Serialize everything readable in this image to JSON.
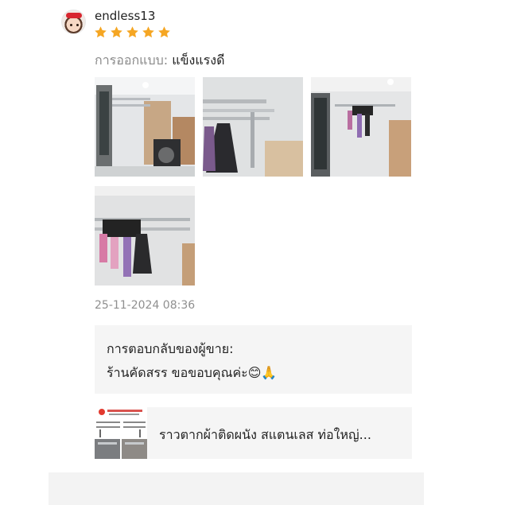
{
  "review": {
    "username": "endless13",
    "rating": 5,
    "rating_max": 5,
    "star_color": "#f5a623",
    "attribute_label": "การออกแบบ:",
    "attribute_value": "แข็งแรงดี",
    "photos": [
      {
        "depicts": "wall clothes rack beside washing machine"
      },
      {
        "depicts": "stainless rack with hanging clothes"
      },
      {
        "depicts": "rack with towel on wall"
      },
      {
        "depicts": "rack with hanging laundry"
      }
    ],
    "timestamp": "25-11-2024 08:36"
  },
  "seller_reply": {
    "title": "การตอบกลับของผู้ขาย:",
    "text": "ร้านคัดสรร ขอขอบคุณค่ะ😊🙏"
  },
  "product": {
    "name": "ราวตากผ้าติดผนัง สแตนเลส ท่อใหญ่..."
  },
  "icons": {
    "avatar": "avatar-image",
    "star": "star-icon"
  }
}
